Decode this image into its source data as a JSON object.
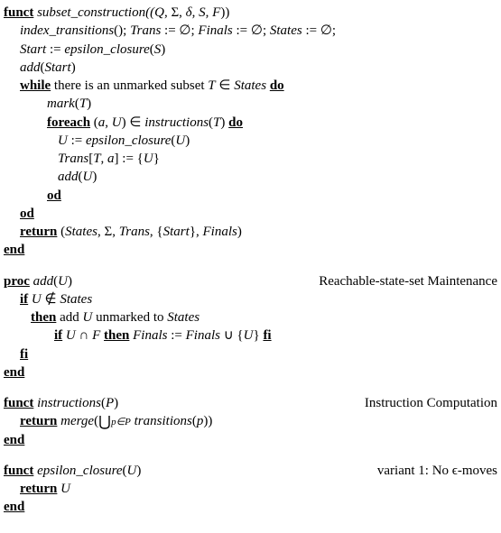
{
  "p1": {
    "funct": "funct",
    "name": "subset_construction",
    "args_open": "((",
    "Q": "Q",
    "comma1": ", Σ, ",
    "delta": "δ",
    "comma2": ", ",
    "S": "S",
    "comma3": ", ",
    "F": "F",
    "args_close": "))",
    "l1a": "index_transitions",
    "l1b": "();  ",
    "Trans": "Trans",
    "l1c": " := ∅;  ",
    "Finals": "Finals",
    "l1d": " := ∅;  ",
    "States": "States",
    "l1e": " := ∅;",
    "l2a": "Start",
    "l2b": " := ",
    "ec": "epsilon_closure",
    "l2c": "(",
    "l2d": ")",
    "add": "add",
    "lpar": "(",
    "rpar": ")",
    "while": "while",
    "while_body1": "  there is an unmarked subset ",
    "T": "T",
    "while_body2": " ∈ ",
    "do": "do",
    "mark": "mark",
    "foreach": "foreach",
    "fe_body1": " (",
    "a": "a",
    "fe_comma": ", ",
    "U": "U",
    "fe_body2": ") ∈ ",
    "instr": "instructions",
    "fe_body3": "(",
    "fe_body4": ") ",
    "u_ec1": " := ",
    "trans_idx1": "[",
    "trans_idx2": ", ",
    "trans_idx3": "] := {",
    "trans_idx4": "}",
    "od": "od",
    "return": "return",
    "ret_body1": " (",
    "ret_body2": ", Σ, ",
    "ret_body3": ", {",
    "ret_body4": "}, ",
    "ret_body5": ")",
    "end": "end"
  },
  "p2": {
    "proc": "proc",
    "add": "add",
    "lpar": "(",
    "U": "U",
    "rpar": ")",
    "title": "Reachable-state-set Maintenance",
    "if": "if",
    "body1": " ",
    "notin": " ∉ ",
    "States": "States",
    "then": "then",
    "then_body1": "  add ",
    "then_body2": " unmarked to ",
    "if2_body1": " ",
    "cap": " ∩ ",
    "F": "F",
    "Finals": "Finals",
    "assign": " := ",
    "cup": " ∪ {",
    "close": "} ",
    "fi": "fi",
    "end": "end"
  },
  "p3": {
    "funct": "funct",
    "name": "instructions",
    "lpar": "(",
    "P": "P",
    "rpar": ")",
    "title": "Instruction Computation",
    "return": "return",
    "merge": "merge",
    "lpar2": "(",
    "sub": "p∈P",
    "transitions": "transitions",
    "lpar3": "(",
    "p": "p",
    "rpar3": "))",
    "end": "end"
  },
  "p4": {
    "funct": "funct",
    "name": "epsilon_closure",
    "lpar": "(",
    "U": "U",
    "rpar": ")",
    "title": "variant 1: No ϵ-moves",
    "return": "return",
    "end": "end"
  }
}
